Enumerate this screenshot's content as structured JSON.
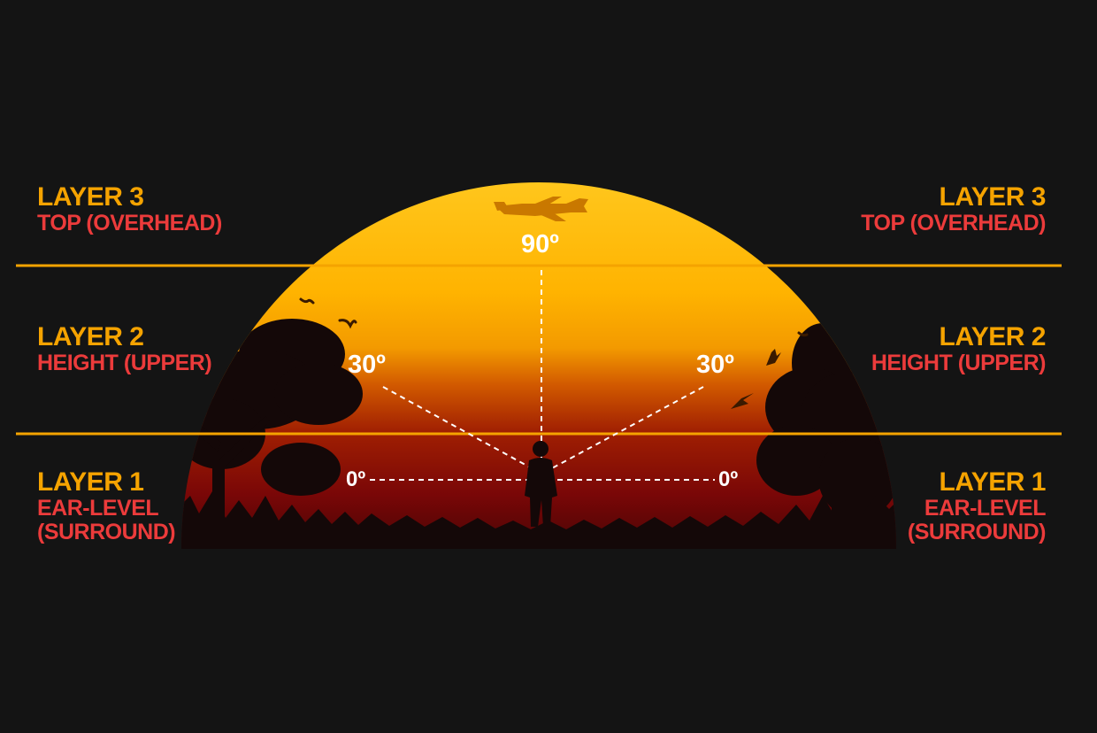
{
  "layers": {
    "left": [
      {
        "title": "LAYER 3",
        "subtitle_lines": [
          "TOP (OVERHEAD)"
        ]
      },
      {
        "title": "LAYER 2",
        "subtitle_lines": [
          "HEIGHT (UPPER)"
        ]
      },
      {
        "title": "LAYER 1",
        "subtitle_lines": [
          "EAR-LEVEL",
          "(SURROUND)"
        ]
      }
    ],
    "right": [
      {
        "title": "LAYER 3",
        "subtitle_lines": [
          "TOP (OVERHEAD)"
        ]
      },
      {
        "title": "LAYER 2",
        "subtitle_lines": [
          "HEIGHT (UPPER)"
        ]
      },
      {
        "title": "LAYER 1",
        "subtitle_lines": [
          "EAR-LEVEL",
          "(SURROUND)"
        ]
      }
    ]
  },
  "angles": {
    "top": "90º",
    "upper_left": "30º",
    "upper_right": "30º",
    "ear_left": "0º",
    "ear_right": "0º"
  },
  "colors": {
    "background": "#141414",
    "layer_title": "#f5a300",
    "layer_subtitle": "#ec3b3b",
    "divider_line": "#f5a300",
    "sun_top": "#ffc21a",
    "sun_mid": "#f09a00",
    "sun_bottom": "#8a0a0a",
    "silhouette": "#140808"
  },
  "icons": [
    "airplane-icon",
    "bird-icon",
    "person-silhouette",
    "tree-silhouette",
    "grass-silhouette"
  ]
}
